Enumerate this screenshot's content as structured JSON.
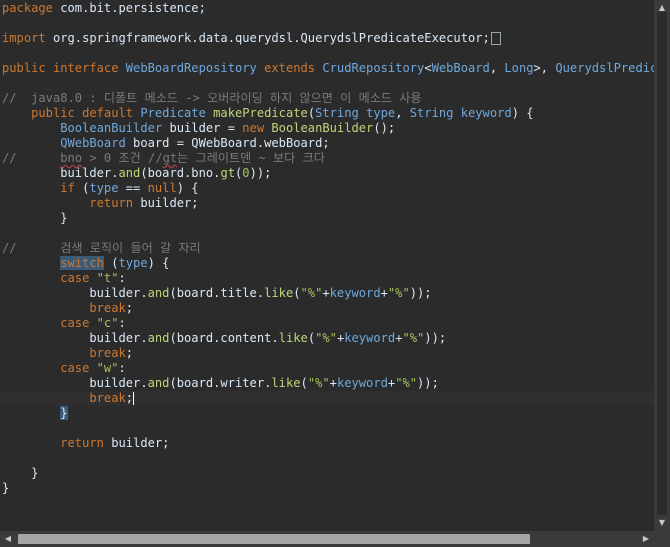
{
  "editor": {
    "lines": [
      [
        {
          "c": "kw",
          "t": "package"
        },
        {
          "c": "pl",
          "t": " com.bit.persistence;"
        }
      ],
      [],
      [
        {
          "c": "kw",
          "t": "import"
        },
        {
          "c": "pl",
          "t": " org.springframework.data.querydsl.QuerydslPredicateExecutor;"
        },
        {
          "c": "fold",
          "t": ""
        }
      ],
      [],
      [
        {
          "c": "kw",
          "t": "public interface"
        },
        {
          "c": "pl",
          "t": " "
        },
        {
          "c": "ty",
          "t": "WebBoardRepository"
        },
        {
          "c": "pl",
          "t": " "
        },
        {
          "c": "kw",
          "t": "extends"
        },
        {
          "c": "pl",
          "t": " "
        },
        {
          "c": "ty",
          "t": "CrudRepository"
        },
        {
          "c": "pl",
          "t": "<"
        },
        {
          "c": "ty",
          "t": "WebBoard"
        },
        {
          "c": "pl",
          "t": ", "
        },
        {
          "c": "ty",
          "t": "Long"
        },
        {
          "c": "pl",
          "t": ">, "
        },
        {
          "c": "ty",
          "t": "QuerydslPredicate"
        }
      ],
      [],
      [
        {
          "c": "cm",
          "t": "//  java8.0 : 디폴트 메소드 -> 오버라이딩 하지 않으면 이 메소드 사용"
        }
      ],
      [
        {
          "c": "kw",
          "t": "    public default"
        },
        {
          "c": "pl",
          "t": " "
        },
        {
          "c": "ty",
          "t": "Predicate"
        },
        {
          "c": "pl",
          "t": " "
        },
        {
          "c": "fn",
          "t": "makePredicate"
        },
        {
          "c": "pl",
          "t": "("
        },
        {
          "c": "ty",
          "t": "String"
        },
        {
          "c": "pl",
          "t": " "
        },
        {
          "c": "ty",
          "t": "type"
        },
        {
          "c": "pl",
          "t": ", "
        },
        {
          "c": "ty",
          "t": "String"
        },
        {
          "c": "pl",
          "t": " "
        },
        {
          "c": "ty",
          "t": "keyword"
        },
        {
          "c": "pl",
          "t": ") {"
        }
      ],
      [
        {
          "c": "ty",
          "t": "        BooleanBuilder"
        },
        {
          "c": "pl",
          "t": " builder = "
        },
        {
          "c": "kw",
          "t": "new"
        },
        {
          "c": "pl",
          "t": " "
        },
        {
          "c": "fn",
          "t": "BooleanBuilder"
        },
        {
          "c": "pl",
          "t": "();"
        }
      ],
      [
        {
          "c": "ty",
          "t": "        QWebBoard"
        },
        {
          "c": "pl",
          "t": " board = QWebBoard.webBoard;"
        }
      ],
      [
        {
          "c": "cm",
          "t": "//      "
        },
        {
          "c": "cm squig",
          "t": "bno"
        },
        {
          "c": "cm",
          "t": " > 0 조건 //"
        },
        {
          "c": "cm squig",
          "t": "gt"
        },
        {
          "c": "cm",
          "t": "는 그레이트덴 ~ 보다 크다"
        }
      ],
      [
        {
          "c": "pl",
          "t": "        builder."
        },
        {
          "c": "fn",
          "t": "and"
        },
        {
          "c": "pl",
          "t": "(board.bno."
        },
        {
          "c": "fn",
          "t": "gt"
        },
        {
          "c": "pl",
          "t": "("
        },
        {
          "c": "str",
          "t": "0"
        },
        {
          "c": "pl",
          "t": "));"
        }
      ],
      [
        {
          "c": "kw",
          "t": "        if"
        },
        {
          "c": "pl",
          "t": " ("
        },
        {
          "c": "ty",
          "t": "type"
        },
        {
          "c": "pl",
          "t": " == "
        },
        {
          "c": "kw",
          "t": "null"
        },
        {
          "c": "pl",
          "t": ") {"
        }
      ],
      [
        {
          "c": "kw",
          "t": "            return"
        },
        {
          "c": "pl",
          "t": " builder;"
        }
      ],
      [
        {
          "c": "pl",
          "t": "        }"
        }
      ],
      [],
      [
        {
          "c": "cm",
          "t": "//      검색 로직이 들어 갈 자리"
        }
      ],
      [
        {
          "c": "pl",
          "t": "        "
        },
        {
          "c": "kw hl",
          "t": "switch"
        },
        {
          "c": "pl",
          "t": " ("
        },
        {
          "c": "ty",
          "t": "type"
        },
        {
          "c": "pl",
          "t": ") {"
        }
      ],
      [
        {
          "c": "kw",
          "t": "        case"
        },
        {
          "c": "pl",
          "t": " "
        },
        {
          "c": "str",
          "t": "\"t\""
        },
        {
          "c": "pl",
          "t": ":"
        }
      ],
      [
        {
          "c": "pl",
          "t": "            builder."
        },
        {
          "c": "fn",
          "t": "and"
        },
        {
          "c": "pl",
          "t": "(board.title."
        },
        {
          "c": "fn",
          "t": "like"
        },
        {
          "c": "pl",
          "t": "("
        },
        {
          "c": "str",
          "t": "\"%\""
        },
        {
          "c": "pl",
          "t": "+"
        },
        {
          "c": "ty",
          "t": "keyword"
        },
        {
          "c": "pl",
          "t": "+"
        },
        {
          "c": "str",
          "t": "\"%\""
        },
        {
          "c": "pl",
          "t": "));"
        }
      ],
      [
        {
          "c": "kw",
          "t": "            break"
        },
        {
          "c": "pl",
          "t": ";"
        }
      ],
      [
        {
          "c": "kw",
          "t": "        case"
        },
        {
          "c": "pl",
          "t": " "
        },
        {
          "c": "str",
          "t": "\"c\""
        },
        {
          "c": "pl",
          "t": ":"
        }
      ],
      [
        {
          "c": "pl",
          "t": "            builder."
        },
        {
          "c": "fn",
          "t": "and"
        },
        {
          "c": "pl",
          "t": "(board.content."
        },
        {
          "c": "fn",
          "t": "like"
        },
        {
          "c": "pl",
          "t": "("
        },
        {
          "c": "str",
          "t": "\"%\""
        },
        {
          "c": "pl",
          "t": "+"
        },
        {
          "c": "ty",
          "t": "keyword"
        },
        {
          "c": "pl",
          "t": "+"
        },
        {
          "c": "str",
          "t": "\"%\""
        },
        {
          "c": "pl",
          "t": "));"
        }
      ],
      [
        {
          "c": "kw",
          "t": "            break"
        },
        {
          "c": "pl",
          "t": ";"
        }
      ],
      [
        {
          "c": "kw",
          "t": "        case"
        },
        {
          "c": "pl",
          "t": " "
        },
        {
          "c": "str",
          "t": "\"w\""
        },
        {
          "c": "pl",
          "t": ":"
        }
      ],
      [
        {
          "c": "pl",
          "t": "            builder."
        },
        {
          "c": "fn",
          "t": "and"
        },
        {
          "c": "pl",
          "t": "(board.writer."
        },
        {
          "c": "fn",
          "t": "like"
        },
        {
          "c": "pl",
          "t": "("
        },
        {
          "c": "str",
          "t": "\"%\""
        },
        {
          "c": "pl",
          "t": "+"
        },
        {
          "c": "ty",
          "t": "keyword"
        },
        {
          "c": "pl",
          "t": "+"
        },
        {
          "c": "str",
          "t": "\"%\""
        },
        {
          "c": "pl",
          "t": "));"
        }
      ],
      [
        {
          "c": "kw",
          "t": "            break"
        },
        {
          "c": "pl",
          "t": ";"
        },
        {
          "c": "caret",
          "t": ""
        }
      ],
      [
        {
          "c": "pl",
          "t": "        "
        },
        {
          "c": "pl hl",
          "t": "}"
        }
      ],
      [],
      [
        {
          "c": "kw",
          "t": "        return"
        },
        {
          "c": "pl",
          "t": " builder;"
        }
      ],
      [],
      [
        {
          "c": "pl",
          "t": "    }"
        }
      ],
      [
        {
          "c": "pl",
          "t": "}"
        }
      ]
    ],
    "current_line": 26
  },
  "scrollbar": {
    "up_icon": "▲",
    "down_icon": "▼",
    "left_icon": "◀",
    "right_icon": "▶"
  }
}
